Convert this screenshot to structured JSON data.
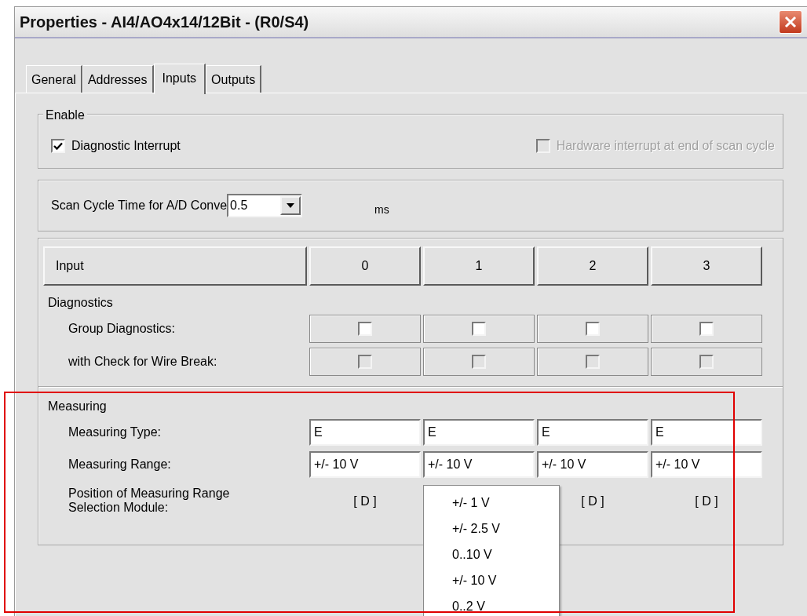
{
  "window": {
    "title": "Properties - AI4/AO4x14/12Bit - (R0/S4)"
  },
  "tabs": [
    {
      "label": "General",
      "selected": false
    },
    {
      "label": "Addresses",
      "selected": false
    },
    {
      "label": "Inputs",
      "selected": true
    },
    {
      "label": "Outputs",
      "selected": false
    }
  ],
  "enable": {
    "title": "Enable",
    "options": [
      {
        "label": "Diagnostic Interrupt",
        "checked": true,
        "disabled": false
      },
      {
        "label": "Hardware interrupt at end of scan cycle",
        "checked": false,
        "disabled": true
      }
    ]
  },
  "scan_cycle": {
    "label": "Scan Cycle Time for A/D Conve",
    "value": "0.5",
    "unit": "ms"
  },
  "table": {
    "header": "Input",
    "columns": [
      "0",
      "1",
      "2",
      "3"
    ],
    "diagnostics": {
      "title": "Diagnostics",
      "rows": [
        {
          "label": "Group Diagnostics:",
          "cells": [
            {
              "checked": false,
              "disabled": false
            },
            {
              "checked": false,
              "disabled": false
            },
            {
              "checked": false,
              "disabled": false
            },
            {
              "checked": false,
              "disabled": false
            }
          ]
        },
        {
          "label": "with Check for Wire Break:",
          "cells": [
            {
              "checked": false,
              "disabled": true
            },
            {
              "checked": false,
              "disabled": true
            },
            {
              "checked": false,
              "disabled": true
            },
            {
              "checked": false,
              "disabled": true
            }
          ]
        }
      ]
    },
    "measuring": {
      "title": "Measuring",
      "rows": [
        {
          "label": "Measuring Type:",
          "kind": "field",
          "values": [
            "E",
            "E",
            "E",
            "E"
          ]
        },
        {
          "label": "Measuring Range:",
          "kind": "field",
          "values": [
            "+/- 10 V",
            "+/- 10 V",
            "+/- 10 V",
            "+/- 10 V"
          ],
          "dropdown": {
            "open": true,
            "items": [
              "+/- 1 V",
              "+/- 2.5 V",
              "0..10 V",
              "+/- 10 V",
              "0..2 V"
            ]
          }
        },
        {
          "label": "Position of Measuring Range Selection Module:",
          "kind": "text",
          "values": [
            "[ D ]",
            "[ D ]",
            "[ D ]"
          ]
        }
      ]
    }
  }
}
